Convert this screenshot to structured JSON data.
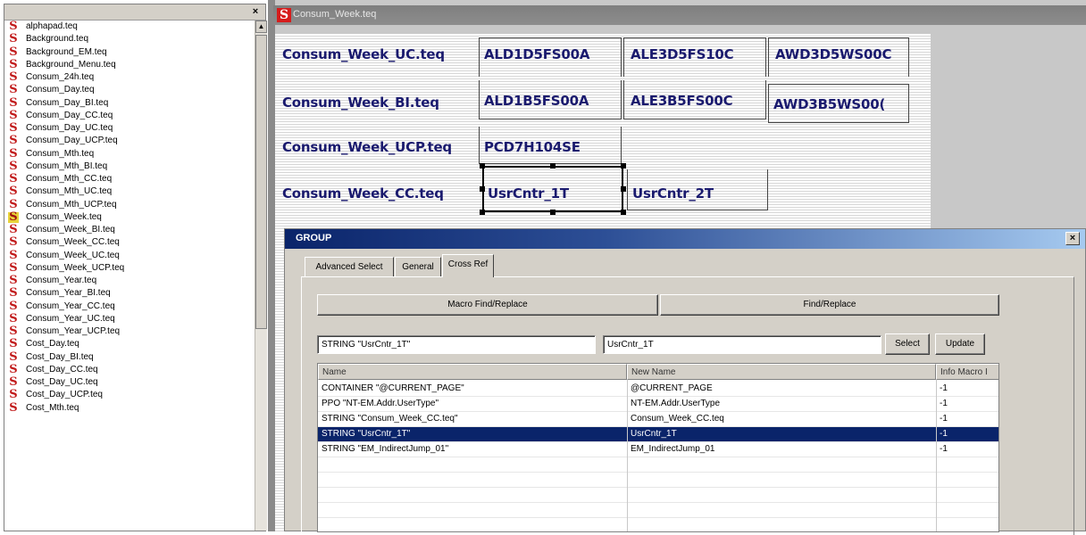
{
  "file_list": {
    "close_label": "×",
    "items": [
      {
        "label": "alphapad.teq"
      },
      {
        "label": "Background.teq"
      },
      {
        "label": "Background_EM.teq"
      },
      {
        "label": "Background_Menu.teq"
      },
      {
        "label": "Consum_24h.teq"
      },
      {
        "label": "Consum_Day.teq"
      },
      {
        "label": "Consum_Day_BI.teq"
      },
      {
        "label": "Consum_Day_CC.teq"
      },
      {
        "label": "Consum_Day_UC.teq"
      },
      {
        "label": "Consum_Day_UCP.teq"
      },
      {
        "label": "Consum_Mth.teq"
      },
      {
        "label": "Consum_Mth_BI.teq"
      },
      {
        "label": "Consum_Mth_CC.teq"
      },
      {
        "label": "Consum_Mth_UC.teq"
      },
      {
        "label": "Consum_Mth_UCP.teq"
      },
      {
        "label": "Consum_Week.teq",
        "selected": true
      },
      {
        "label": "Consum_Week_BI.teq"
      },
      {
        "label": "Consum_Week_CC.teq"
      },
      {
        "label": "Consum_Week_UC.teq"
      },
      {
        "label": "Consum_Week_UCP.teq"
      },
      {
        "label": "Consum_Year.teq"
      },
      {
        "label": "Consum_Year_BI.teq"
      },
      {
        "label": "Consum_Year_CC.teq"
      },
      {
        "label": "Consum_Year_UC.teq"
      },
      {
        "label": "Consum_Year_UCP.teq"
      },
      {
        "label": "Cost_Day.teq"
      },
      {
        "label": "Cost_Day_BI.teq"
      },
      {
        "label": "Cost_Day_CC.teq"
      },
      {
        "label": "Cost_Day_UC.teq"
      },
      {
        "label": "Cost_Day_UCP.teq"
      },
      {
        "label": "Cost_Mth.teq"
      }
    ],
    "icon_glyph": "S",
    "icon_color": "#c11a1a"
  },
  "editor": {
    "title": "Consum_Week.teq",
    "icon_glyph": "S",
    "rows": [
      {
        "label": "Consum_Week_UC.teq",
        "tags": [
          "ALD1D5FS00A",
          "ALE3D5FS10C",
          "AWD3D5WS00C"
        ]
      },
      {
        "label": "Consum_Week_BI.teq",
        "tags": [
          "ALD1B5FS00A",
          "ALE3B5FS00C",
          "AWD3B5WS00("
        ]
      },
      {
        "label": "Consum_Week_UCP.teq",
        "tags": [
          "PCD7H104SE"
        ]
      },
      {
        "label": "Consum_Week_CC.teq",
        "tags": [
          "UsrCntr_1T",
          "UsrCntr_2T"
        ]
      }
    ]
  },
  "dialog": {
    "title": "GROUP",
    "close_label": "×",
    "tabs": [
      "Advanced Select",
      "General",
      "Cross Ref"
    ],
    "active_tab": "Cross Ref",
    "macro_button": "Macro Find/Replace",
    "find_button": "Find/Replace",
    "find_value": "STRING \"UsrCntr_1T\"",
    "replace_value": "UsrCntr_1T",
    "select_button": "Select",
    "update_button": "Update",
    "columns": [
      "Name",
      "New Name",
      "Info Macro I"
    ],
    "rows": [
      {
        "name": "CONTAINER \"@CURRENT_PAGE\"",
        "new_name": "@CURRENT_PAGE",
        "info": "-1"
      },
      {
        "name": "PPO \"NT-EM.Addr.UserType\"",
        "new_name": "NT-EM.Addr.UserType",
        "info": "-1"
      },
      {
        "name": "STRING \"Consum_Week_CC.teq\"",
        "new_name": "Consum_Week_CC.teq",
        "info": "-1"
      },
      {
        "name": "STRING \"UsrCntr_1T\"",
        "new_name": "UsrCntr_1T",
        "info": "-1",
        "selected": true
      },
      {
        "name": "STRING \"EM_IndirectJump_01\"",
        "new_name": "EM_IndirectJump_01",
        "info": "-1"
      }
    ],
    "selection_color": "#0a246a"
  }
}
